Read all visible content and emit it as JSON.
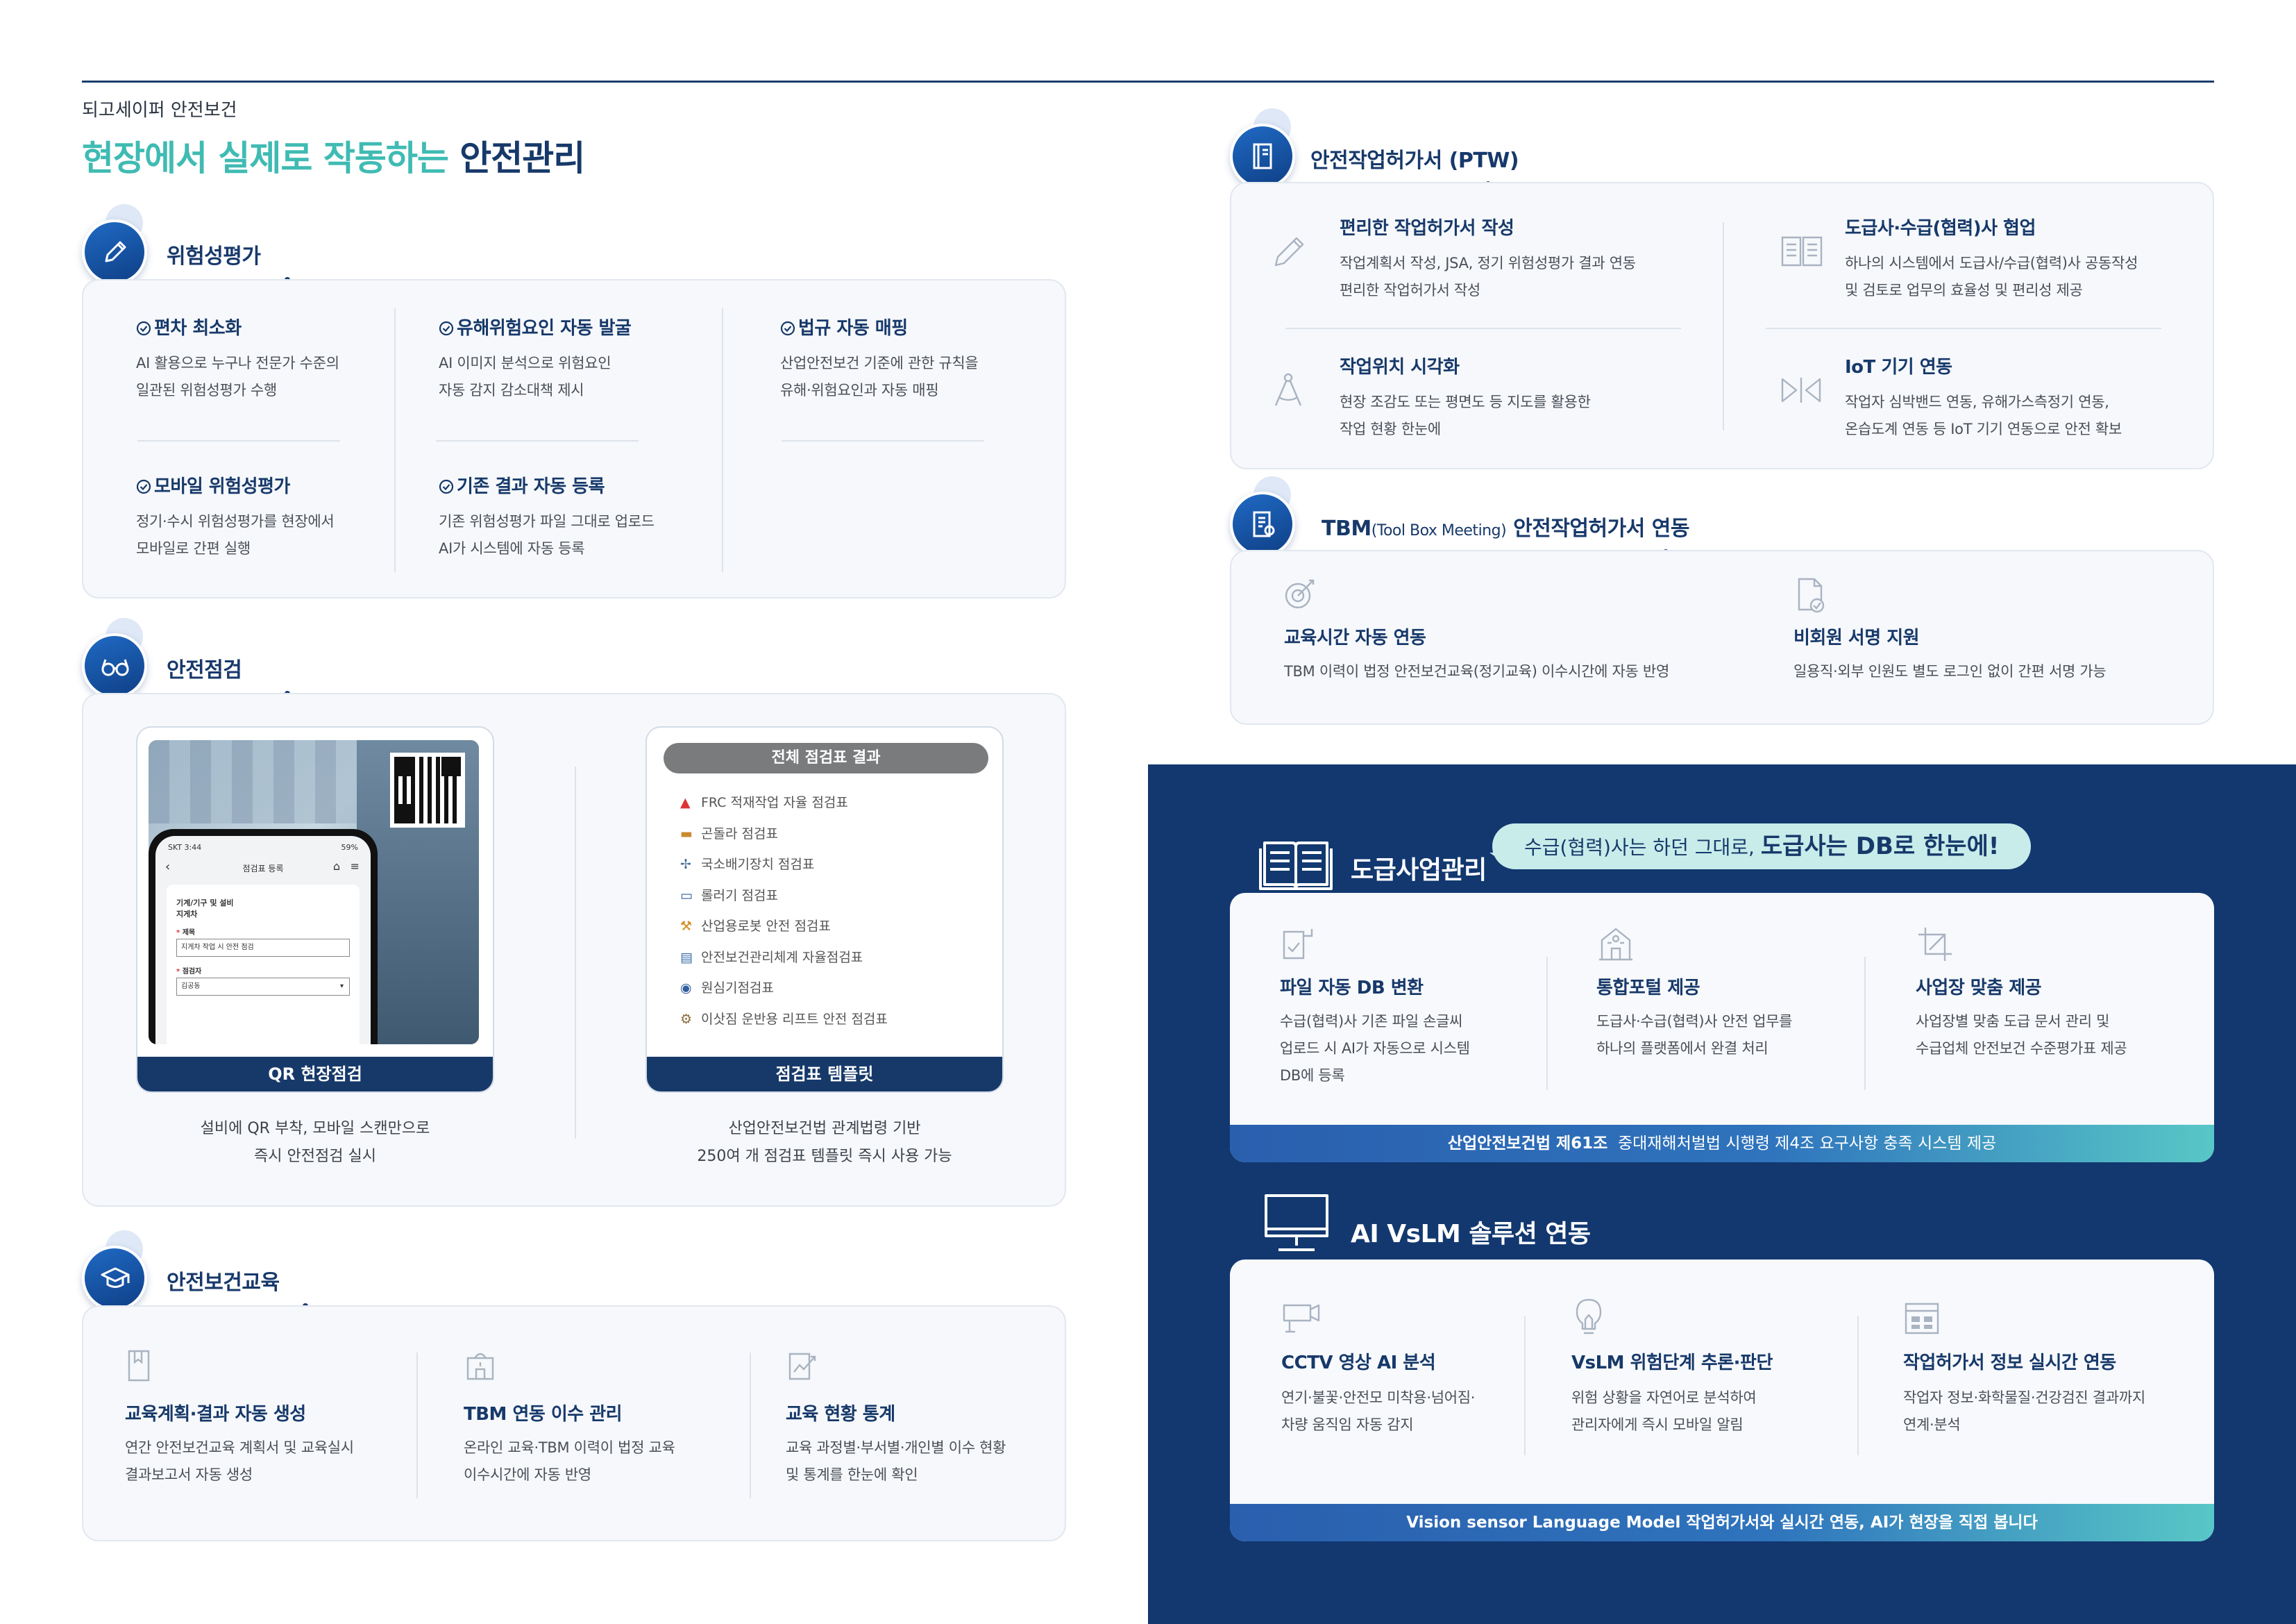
{
  "header": {
    "brand": "되고세이퍼 안전보건",
    "headline_highlight": "현장에서 실제로 작동하는",
    "headline_main": "안전관리"
  },
  "risk": {
    "title": "위험성평가",
    "items": [
      {
        "title": "편차 최소화",
        "desc1": "AI 활용으로 누구나 전문가 수준의",
        "desc2": "일관된 위험성평가 수행"
      },
      {
        "title": "유해위험요인 자동 발굴",
        "desc1": "AI 이미지 분석으로 위험요인",
        "desc2": "자동 감지 감소대책 제시"
      },
      {
        "title": "법규 자동 매핑",
        "desc1": "산업안전보건 기준에 관한 규칙을",
        "desc2": "유해·위험요인과 자동 매핑"
      },
      {
        "title": "모바일 위험성평가",
        "desc1": "정기·수시 위험성평가를 현장에서",
        "desc2": "모바일로 간편 실행"
      },
      {
        "title": "기존 결과 자동 등록",
        "desc1": "기존 위험성평가 파일 그대로 업로드",
        "desc2": "AI가 시스템에 자동 등록"
      }
    ]
  },
  "inspection": {
    "title": "안전점검",
    "qr": {
      "footer": "QR 현장점검",
      "caption1": "설비에 QR 부착, 모바일 스캔만으로",
      "caption2": "즉시 안전점검 실시",
      "phone": {
        "status_left": "SKT 3:44",
        "status_right": "59%",
        "screen_title": "점검표 등록",
        "section": "기계/기구 및 설비",
        "section2": "지게차",
        "label1": "제목",
        "field1": "지게차 작업 시 안전 점검",
        "label2": "점검자",
        "field2": "김공동"
      }
    },
    "template": {
      "header": "전체 점검표 결과",
      "list": [
        "FRC 적재작업 자율 점검표",
        "곤돌라 점검표",
        "국소배기장치 점검표",
        "롤러기 점검표",
        "산업용로봇 안전 점검표",
        "안전보건관리체계 자율점검표",
        "원심기점검표",
        "이삿짐 운반용 리프트 안전 점검표"
      ],
      "footer": "점검표 템플릿",
      "caption1": "산업안전보건법 관계법령 기반",
      "caption2": "250여 개 점검표 템플릿 즉시 사용 가능"
    }
  },
  "education": {
    "title": "안전보건교육",
    "items": [
      {
        "icon": "document-icon",
        "title": "교육계획·결과 자동 생성",
        "desc1": "연간 안전보건교육 계획서 및 교육실시",
        "desc2": "결과보고서 자동 생성"
      },
      {
        "icon": "helmet-icon",
        "title": "TBM 연동 이수 관리",
        "desc1": "온라인 교육·TBM 이력이 법정 교육",
        "desc2": "이수시간에 자동 반영"
      },
      {
        "icon": "chart-icon",
        "title": "교육 현황 통계",
        "desc1": "교육 과정별·부서별·개인별 이수 현황",
        "desc2": "및 통계를 한눈에 확인"
      }
    ]
  },
  "ptw": {
    "title": "안전작업허가서 (PTW)",
    "items": [
      {
        "icon": "pencil-icon",
        "title": "편리한 작업허가서 작성",
        "desc1": "작업계획서 작성, JSA, 정기 위험성평가 결과 연동",
        "desc2": "편리한 작업허가서 작성"
      },
      {
        "icon": "book-open-icon",
        "title": "도급사·수급(협력)사 협업",
        "desc1": "하나의 시스템에서 도급사/수급(협력)사 공동작성",
        "desc2": "및 검토로 업무의 효율성 및 편리성 제공"
      },
      {
        "icon": "compass-icon",
        "title": "작업위치 시각화",
        "desc1": "현장 조감도 또는 평면도 등 지도를 활용한",
        "desc2": "작업 현황 한눈에"
      },
      {
        "icon": "sensor-icon",
        "title": "IoT 기기 연동",
        "desc1": "작업자 심박밴드 연동, 유해가스측정기 연동,",
        "desc2": "온습도계 연동 등 IoT 기기 연동으로 안전 확보"
      }
    ]
  },
  "tbm": {
    "title_main": "TBM",
    "title_small": "(Tool Box Meeting)",
    "title_rest": " 안전작업허가서 연동",
    "items": [
      {
        "icon": "target-icon",
        "title": "교육시간 자동 연동",
        "desc": "TBM 이력이 법정 안전보건교육(정기교육) 이수시간에 자동 반영"
      },
      {
        "icon": "signed-doc-icon",
        "title": "비회원 서명 지원",
        "desc": "일용직·외부 인원도 별도 로그인 없이 간편 서명 가능"
      }
    ]
  },
  "subcontract": {
    "title": "도급사업관리",
    "bubble_pre": "수급(협력)사는 하던 그대로, ",
    "bubble_bold": "도급사는 DB로 한눈에!",
    "items": [
      {
        "icon": "file-check-icon",
        "title": "파일 자동 DB 변환",
        "desc1": "수급(협력)사 기존 파일 손글씨",
        "desc2": "업로드 시 AI가 자동으로 시스템",
        "desc3": "DB에 등록"
      },
      {
        "icon": "building-icon",
        "title": "통합포털 제공",
        "desc1": "도급사·수급(협력)사 안전 업무를",
        "desc2": "하나의 플랫폼에서 완결 처리",
        "desc3": ""
      },
      {
        "icon": "crop-icon",
        "title": "사업장 맞춤 제공",
        "desc1": "사업장별 맞춤 도급 문서 관리 및",
        "desc2": "수급업체 안전보건 수준평가표 제공",
        "desc3": ""
      }
    ],
    "bar_bold": "산업안전보건법 제61조",
    "bar_rest": "중대재해처벌법 시행령 제4조 요구사항 충족 시스템 제공"
  },
  "vslm": {
    "title": "AI VsLM 솔루션 연동",
    "items": [
      {
        "icon": "cctv-icon",
        "title": "CCTV 영상 AI 분석",
        "desc1": "연기·불꽃·안전모 미착용·넘어짐·",
        "desc2": "차량 움직임 자동 감지"
      },
      {
        "icon": "bulb-icon",
        "title": "VsLM 위험단계 추론·판단",
        "desc1": "위험 상황을 자연어로 분석하여",
        "desc2": "관리자에게 즉시 모바일 알림"
      },
      {
        "icon": "table-icon",
        "title": "작업허가서 정보 실시간 연동",
        "desc1": "작업자 정보·화학물질·건강검진 결과까지",
        "desc2": "연계·분석"
      }
    ],
    "bar": "Vision sensor Language Model 작업허가서와 실시간 연동, AI가 현장을 직접 봅니다"
  },
  "colors": {
    "navy": "#17396a",
    "teal": "#3fbbb3",
    "dark_bg": "#12386f",
    "panel": "#f6f8fb"
  }
}
